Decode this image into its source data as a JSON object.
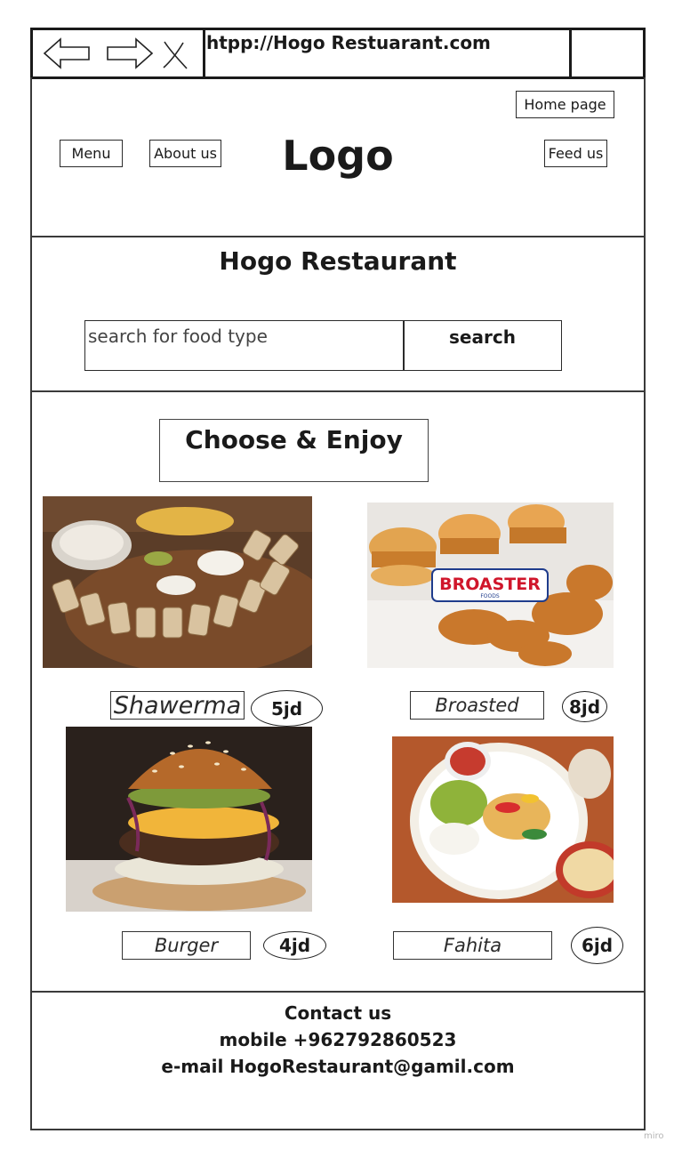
{
  "browser": {
    "url": "htpp://Hogo Restuarant.com",
    "icons": [
      "back-arrow-icon",
      "forward-arrow-icon",
      "close-x-icon"
    ]
  },
  "header": {
    "home_label": "Home page",
    "menu_label": "Menu",
    "about_label": "About us",
    "logo_text": "Logo",
    "feed_label": "Feed us"
  },
  "hero": {
    "title": "Hogo Restaurant",
    "search_placeholder": "search for food type",
    "search_button": "search"
  },
  "menu_section": {
    "heading": "Choose & Enjoy",
    "items": [
      {
        "name": "Shawerma",
        "price": "5jd"
      },
      {
        "name": "Broasted",
        "price": "8jd",
        "image_brand_text": "BROASTER",
        "image_brand_sub": "FOODS"
      },
      {
        "name": "Burger",
        "price": "4jd"
      },
      {
        "name": "Fahita",
        "price": "6jd"
      }
    ]
  },
  "contact": {
    "title": "Contact us",
    "mobile": "mobile +962792860523",
    "email": "e-mail HogoRestaurant@gamil.com"
  },
  "watermark": "miro"
}
